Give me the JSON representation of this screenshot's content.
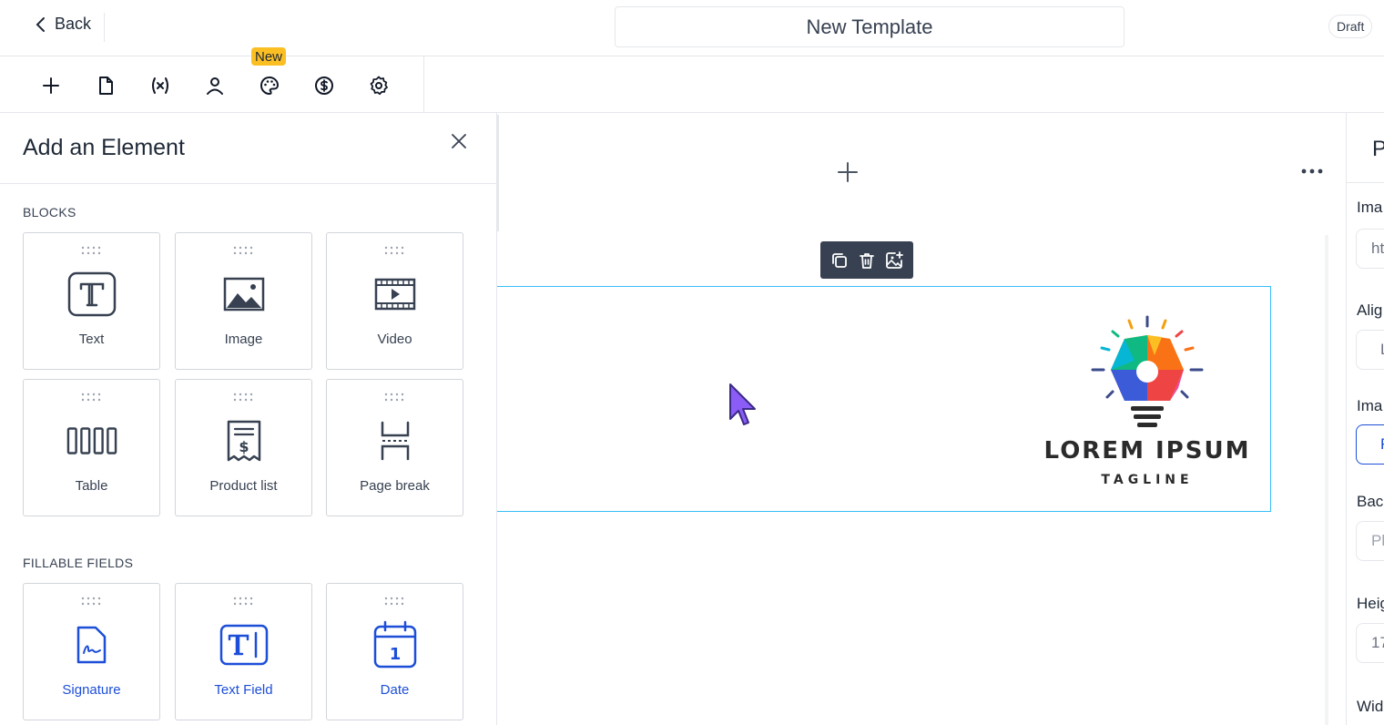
{
  "header": {
    "back_label": "Back",
    "template_title": "New Template",
    "status_badge": "Draft"
  },
  "toolbar": {
    "new_badge": "New",
    "tools": [
      {
        "name": "add-icon"
      },
      {
        "name": "document-icon"
      },
      {
        "name": "variable-icon"
      },
      {
        "name": "user-icon"
      },
      {
        "name": "palette-icon"
      },
      {
        "name": "dollar-circle-icon"
      },
      {
        "name": "settings-gear-icon"
      }
    ]
  },
  "left_panel": {
    "title": "Add an Element",
    "blocks_heading": "BLOCKS",
    "blocks": [
      {
        "label": "Text",
        "icon": "text-icon"
      },
      {
        "label": "Image",
        "icon": "image-icon"
      },
      {
        "label": "Video",
        "icon": "video-icon"
      },
      {
        "label": "Table",
        "icon": "table-icon"
      },
      {
        "label": "Product list",
        "icon": "receipt-icon"
      },
      {
        "label": "Page break",
        "icon": "page-break-icon"
      }
    ],
    "fillable_heading": "FILLABLE FIELDS",
    "fillable_fields": [
      {
        "label": "Signature",
        "icon": "signature-icon"
      },
      {
        "label": "Text Field",
        "icon": "text-field-icon"
      },
      {
        "label": "Date",
        "icon": "calendar-icon"
      }
    ]
  },
  "canvas": {
    "image_block": {
      "logo_title": "LOREM IPSUM",
      "logo_tagline": "TAGLINE"
    },
    "image_toolbar": [
      "duplicate-icon",
      "trash-icon",
      "replace-image-icon"
    ]
  },
  "right_panel": {
    "title_fragment": "P",
    "labels": [
      "Ima",
      "Alig",
      "Ima",
      "Bac",
      "Heig",
      "Wid"
    ],
    "fields": [
      "ht",
      "L",
      "F",
      "Pl",
      "17"
    ]
  },
  "colors": {
    "accent_blue": "#1d4ed8",
    "new_badge": "#fbbf24",
    "selection_border": "#38bdf8",
    "cursor": "#8b5cf6"
  }
}
